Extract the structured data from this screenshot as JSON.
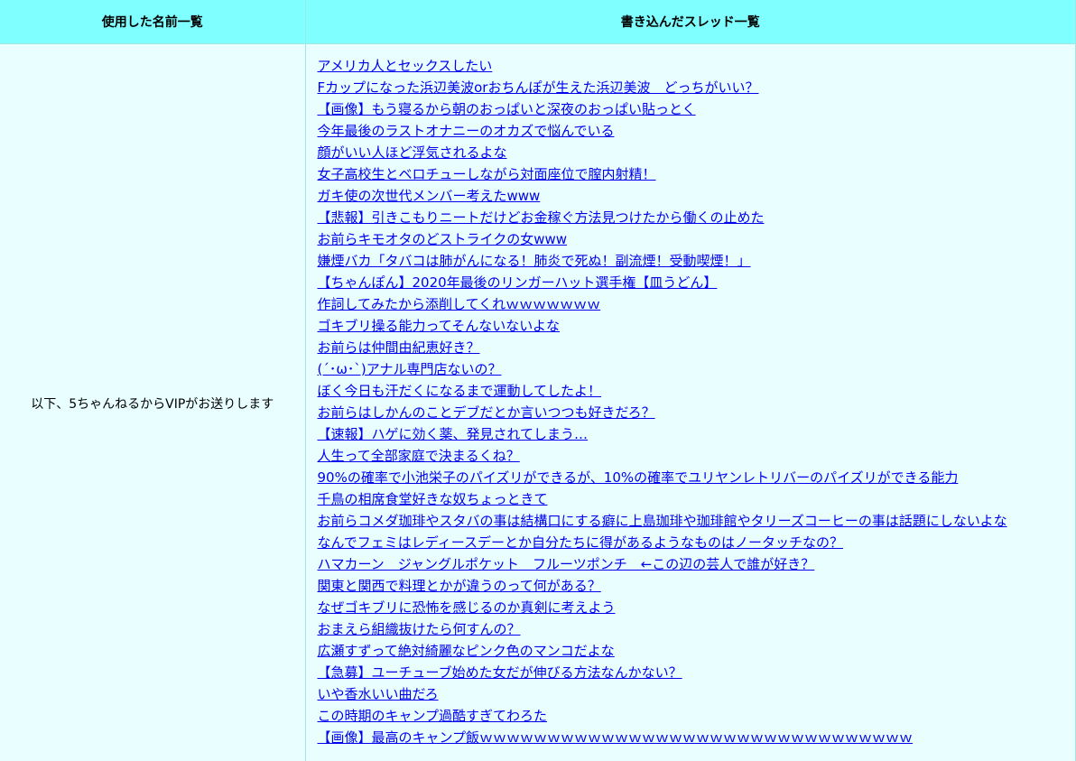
{
  "headers": {
    "names": "使用した名前一覧",
    "threads": "書き込んだスレッド一覧"
  },
  "names": [
    "以下、5ちゃんねるからVIPがお送りします"
  ],
  "threads": [
    "アメリカ人とセックスしたい",
    "Fカップになった浜辺美波orおちんぽが生えた浜辺美波　どっちがいい？",
    "【画像】もう寝るから朝のおっぱいと深夜のおっぱい貼っとく",
    "今年最後のラストオナニーのオカズで悩んでいる",
    "顔がいい人ほど浮気されるよな",
    "女子高校生とベロチューしながら対面座位で膣内射精！",
    "ガキ使の次世代メンバー考えたwww",
    "【悲報】引きこもりニートだけどお金稼ぐ方法見つけたから働くの止めた",
    "お前らキモオタのどストライクの女www",
    "嫌煙バカ「タバコは肺がんになる！肺炎で死ぬ！副流煙！受動喫煙！」",
    "【ちゃんぽん】2020年最後のリンガーハット選手権【皿うどん】",
    "作詞してみたから添削してくれｗｗｗｗｗｗｗ",
    "ゴキブリ操る能力ってそんないないよな",
    "お前らは仲間由紀恵好き？",
    "(´･ω･`)アナル専門店ないの？",
    "ぼく今日も汗だくになるまで運動してしたよ！",
    "お前らはしかんのことデブだとか言いつつも好きだろ？",
    "【速報】ハゲに効く薬、発見されてしまう…",
    "人生って全部家庭で決まるくね？",
    "90%の確率で小池栄子のパイズリができるが、10%の確率でユリヤンレトリバーのパイズリができる能力",
    "千鳥の相席食堂好きな奴ちょっときて",
    "お前らコメダ珈琲やスタバの事は結構口にする癖に上島珈琲や珈琲館やタリーズコーヒーの事は話題にしないよな",
    "なんでフェミはレディースデーとか自分たちに得があるようなものはノータッチなの？",
    "ハマカーン　ジャングルポケット　フルーツポンチ　←この辺の芸人で誰が好き？",
    "関東と関西で料理とかが違うのって何がある？",
    "なぜゴキブリに恐怖を感じるのか真剣に考えよう",
    "おまえら組織抜けたら何すんの？",
    "広瀬すずって絶対綺麗なピンク色のマンコだよな",
    "【急募】ユーチューブ始めた女だが伸びる方法なんかない？",
    "いや香水いい曲だろ",
    "この時期のキャンプ過酷すぎてわろた",
    "【画像】最高のキャンプ飯ｗｗｗｗｗｗｗｗｗｗｗｗｗｗｗｗｗｗｗｗｗｗｗｗｗｗｗｗｗｗｗｗ"
  ],
  "colors": {
    "header_bg": "#7fffff",
    "cell_bg": "#e9ffff",
    "link": "#0000ee"
  }
}
